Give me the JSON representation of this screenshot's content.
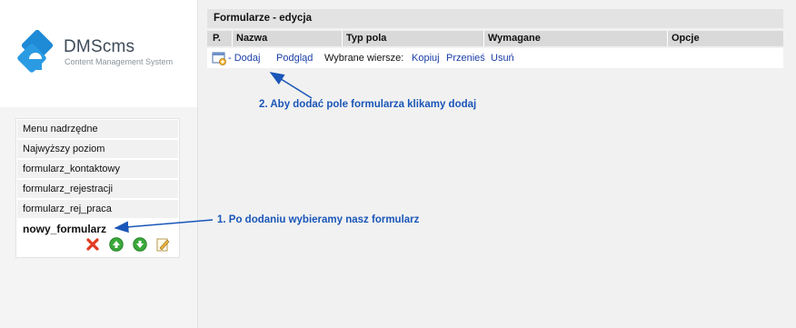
{
  "brand": {
    "name": "DMScms",
    "tagline": "Content Management System",
    "accent_color": "#1f8ad6"
  },
  "sidebar": {
    "items": [
      {
        "label": "Menu nadrzędne"
      },
      {
        "label": "Najwyższy poziom"
      },
      {
        "label": "formularz_kontaktowy"
      },
      {
        "label": "formularz_rejestracji"
      },
      {
        "label": "formularz_rej_praca"
      },
      {
        "label": "nowy_formularz",
        "active": true
      }
    ],
    "actions": [
      {
        "icon": "delete-icon"
      },
      {
        "icon": "move-up-icon"
      },
      {
        "icon": "move-down-icon"
      },
      {
        "icon": "edit-icon"
      }
    ]
  },
  "panel": {
    "title": "Formularze - edycja",
    "columns": [
      "P.",
      "Nazwa",
      "Typ pola",
      "Wymagane",
      "Opcje"
    ],
    "actions": {
      "add_icon": "add-field-icon",
      "add_label": "- Dodaj",
      "preview_label": "Podgląd",
      "selected_rows_label": "Wybrane wiersze:",
      "copy_label": "Kopiuj",
      "move_label": "Przenieś",
      "delete_label": "Usuń"
    }
  },
  "annotations": {
    "step1": "1. Po dodaniu wybieramy nasz formularz",
    "step2": "2. Aby dodać pole formularza klikamy dodaj",
    "color": "#1a56b8"
  }
}
